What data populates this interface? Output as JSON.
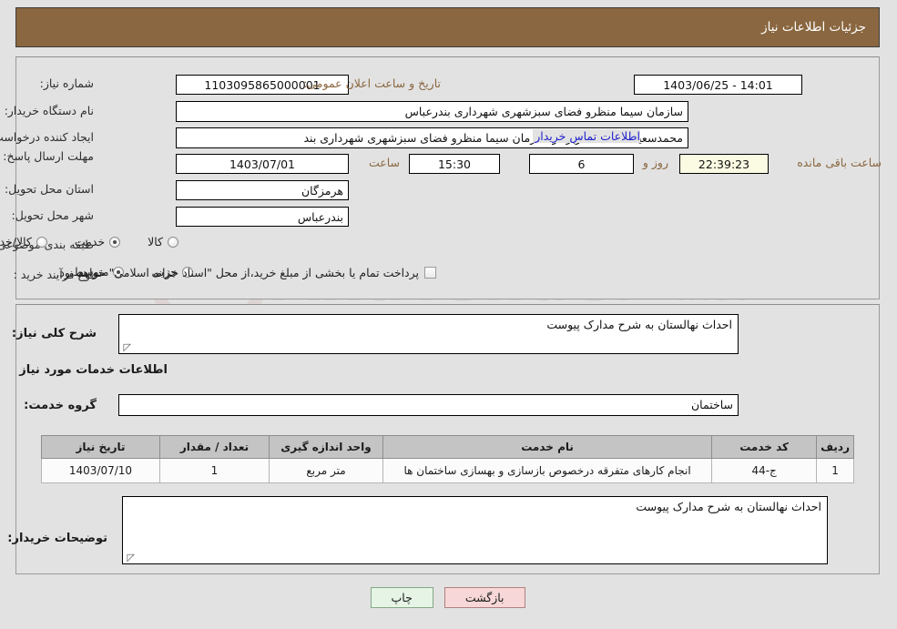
{
  "header": {
    "title": "جزئیات اطلاعات نیاز"
  },
  "form": {
    "need_number_label": "شماره نیاز:",
    "need_number_value": "1103095865000001",
    "announce_label": "تاریخ و ساعت اعلان عمومی:",
    "announce_value": "14:01 - 1403/06/25",
    "buyer_org_label": "نام دستگاه خریدار:",
    "buyer_org_value": "سازمان سیما منظرو فضای سبزشهری شهرداری بندرعباس",
    "creator_label": "ایجاد کننده درخواست:",
    "creator_value": "محمدسعید صداقت کاربرداز سازمان سیما منظرو فضای سبزشهری شهرداری بند",
    "contact_link": "اطلاعات تماس خریدار",
    "deadline_label": "مهلت ارسال پاسخ: تا تاریخ:",
    "deadline_date": "1403/07/01",
    "hour_label": "ساعت",
    "hour_value": "15:30",
    "days_value": "6",
    "days_label": "روز و",
    "remaining_value": "22:39:23",
    "remaining_label": "ساعت باقی مانده",
    "province_label": "استان محل تحویل:",
    "province_value": "هرمزگان",
    "city_label": "شهر محل تحویل:",
    "city_value": "بندرعباس",
    "category_label": "طبقه بندی موضوعی:",
    "category_options": [
      "کالا",
      "خدمت",
      "کالا/خدمت"
    ],
    "category_selected": "خدمت",
    "process_label": "نوع فرآیند خرید :",
    "process_options": [
      "جزیی",
      "متوسط"
    ],
    "process_selected": "متوسط",
    "payment_note": "پرداخت تمام یا بخشی از مبلغ خرید،از محل \"اسناد خزانه اسلامی\" خواهد بود."
  },
  "body": {
    "general_desc_label": "شرح کلی نیاز:",
    "general_desc_value": "احداث نهالستان به شرح مدارک پیوست",
    "services_section_title": "اطلاعات خدمات مورد نیاز",
    "service_group_label": "گروه خدمت:",
    "service_group_value": "ساختمان",
    "buyer_notes_label": "توضیحات خریدار:",
    "buyer_notes_value": "احداث نهالستان به شرح مدارک پیوست"
  },
  "table": {
    "columns": [
      "ردیف",
      "کد خدمت",
      "نام خدمت",
      "واحد اندازه گیری",
      "تعداد / مقدار",
      "تاریخ نیاز"
    ],
    "rows": [
      {
        "row": "1",
        "code": "ج-44",
        "name": "انجام کارهای متفرقه درخصوص بازسازی و بهسازی ساختمان ها",
        "unit": "متر مربع",
        "qty": "1",
        "date": "1403/07/10"
      }
    ]
  },
  "buttons": {
    "back": "بازگشت",
    "print": "چاپ"
  },
  "colors": {
    "header_bg": "#8a6740",
    "accent_brown": "#8a6740",
    "link_blue": "#2222cc",
    "back_btn_bg": "#f7d7d7",
    "print_btn_bg": "#e6f4e6",
    "table_header_bg": "#c4c4c4"
  },
  "watermark": {
    "text": "AnaTender.net"
  }
}
